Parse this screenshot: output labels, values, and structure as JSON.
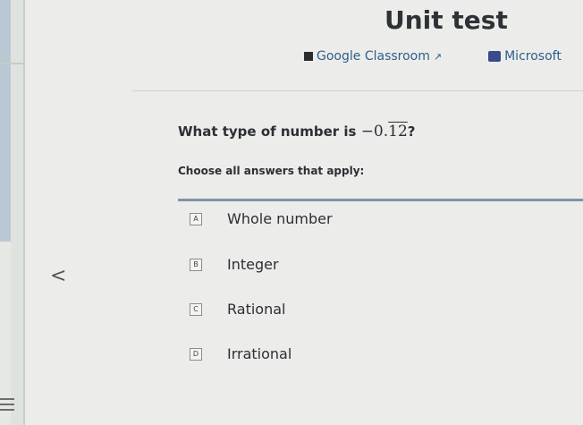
{
  "page_title": "Unit test",
  "links": {
    "google_classroom": "Google Classroom",
    "microsoft": "Microsoft"
  },
  "question": {
    "prefix": "What type of number is ",
    "number_base": "−0.",
    "number_repeat": "12",
    "suffix": "?"
  },
  "instruction": "Choose all answers that apply:",
  "options": [
    {
      "letter": "A",
      "label": "Whole number"
    },
    {
      "letter": "B",
      "label": "Integer"
    },
    {
      "letter": "C",
      "label": "Rational"
    },
    {
      "letter": "D",
      "label": "Irrational"
    }
  ],
  "icons": {
    "back": "chevron-left-icon",
    "menu": "menu-icon",
    "external": "external-link-icon"
  },
  "colors": {
    "accent": "#7e93a6",
    "link": "#2f5d8c"
  }
}
